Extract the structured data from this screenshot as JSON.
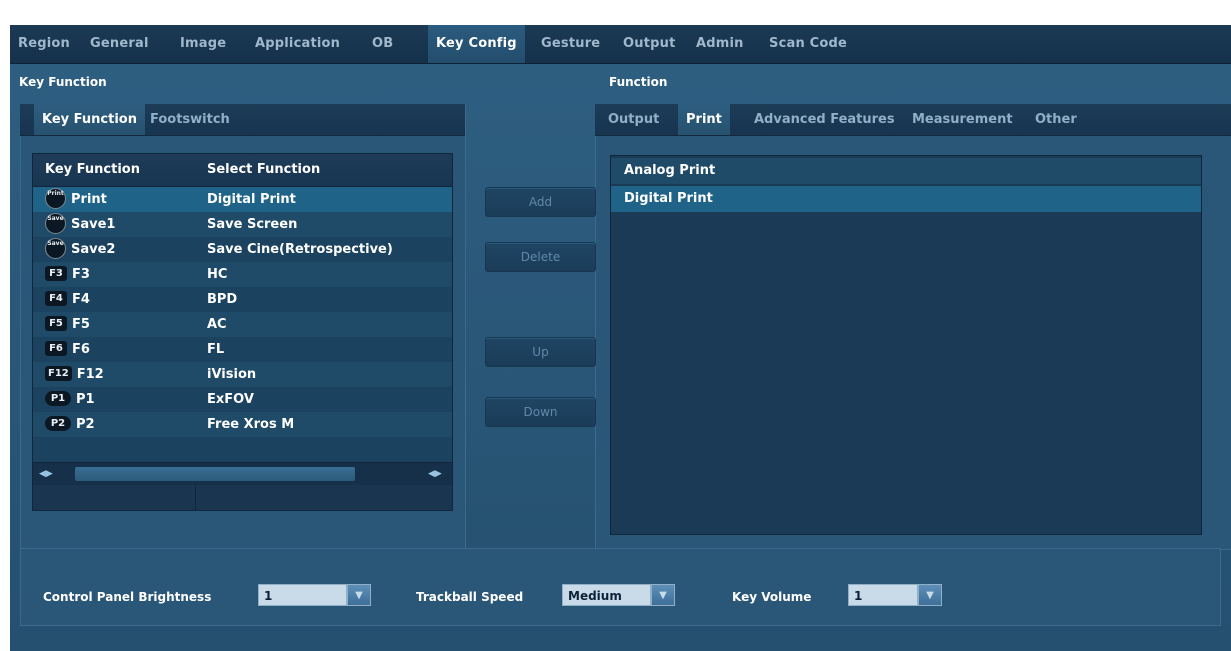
{
  "top_tabs": [
    {
      "label": "Region",
      "active": false
    },
    {
      "label": "General",
      "active": false
    },
    {
      "label": "Image",
      "active": false
    },
    {
      "label": "Application",
      "active": false
    },
    {
      "label": "OB",
      "active": false
    },
    {
      "label": "Key Config",
      "active": true
    },
    {
      "label": "Gesture",
      "active": false
    },
    {
      "label": "Output",
      "active": false
    },
    {
      "label": "Admin",
      "active": false
    },
    {
      "label": "Scan Code",
      "active": false
    }
  ],
  "left": {
    "section_title": "Key Function",
    "tabs": [
      {
        "label": "Key Function",
        "active": true
      },
      {
        "label": "Footswitch",
        "active": false
      }
    ],
    "table": {
      "headers": [
        "Key Function",
        "Select Function"
      ],
      "rows": [
        {
          "key_icon": "print-key-icon",
          "icon_text": "Print",
          "key": "Print",
          "function": "Digital Print",
          "selected": true
        },
        {
          "key_icon": "save-key-icon",
          "icon_text": "Save",
          "key": "Save1",
          "function": "Save Screen",
          "selected": false
        },
        {
          "key_icon": "save-key-icon",
          "icon_text": "Save",
          "key": "Save2",
          "function": "Save Cine(Retrospective)",
          "selected": false
        },
        {
          "key_icon": "f3-key-icon",
          "icon_text": "F3",
          "key": "F3",
          "function": "HC",
          "selected": false
        },
        {
          "key_icon": "f4-key-icon",
          "icon_text": "F4",
          "key": "F4",
          "function": "BPD",
          "selected": false
        },
        {
          "key_icon": "f5-key-icon",
          "icon_text": "F5",
          "key": "F5",
          "function": "AC",
          "selected": false
        },
        {
          "key_icon": "f6-key-icon",
          "icon_text": "F6",
          "key": "F6",
          "function": "FL",
          "selected": false
        },
        {
          "key_icon": "f12-key-icon",
          "icon_text": "F12",
          "key": "F12",
          "function": "iVision",
          "selected": false
        },
        {
          "key_icon": "p1-key-icon",
          "icon_text": "P1",
          "key": "P1",
          "function": "ExFOV",
          "selected": false
        },
        {
          "key_icon": "p2-key-icon",
          "icon_text": "P2",
          "key": "P2",
          "function": "Free Xros M",
          "selected": false
        }
      ]
    }
  },
  "buttons": {
    "add": "Add",
    "delete": "Delete",
    "up": "Up",
    "down": "Down"
  },
  "right": {
    "section_title": "Function",
    "tabs": [
      {
        "label": "Output",
        "active": false
      },
      {
        "label": "Print",
        "active": true
      },
      {
        "label": "Advanced Features",
        "active": false
      },
      {
        "label": "Measurement",
        "active": false
      },
      {
        "label": "Other",
        "active": false
      }
    ],
    "items": [
      {
        "label": "Analog Print",
        "selected": false
      },
      {
        "label": "Digital Print",
        "selected": true
      }
    ]
  },
  "bottom": {
    "brightness_label": "Control Panel Brightness",
    "brightness_value": "1",
    "trackball_label": "Trackball Speed",
    "trackball_value": "Medium",
    "volume_label": "Key Volume",
    "volume_value": "1"
  },
  "colors": {
    "accent": "#1f6488",
    "background": "#2a5678",
    "header": "#14304a"
  }
}
